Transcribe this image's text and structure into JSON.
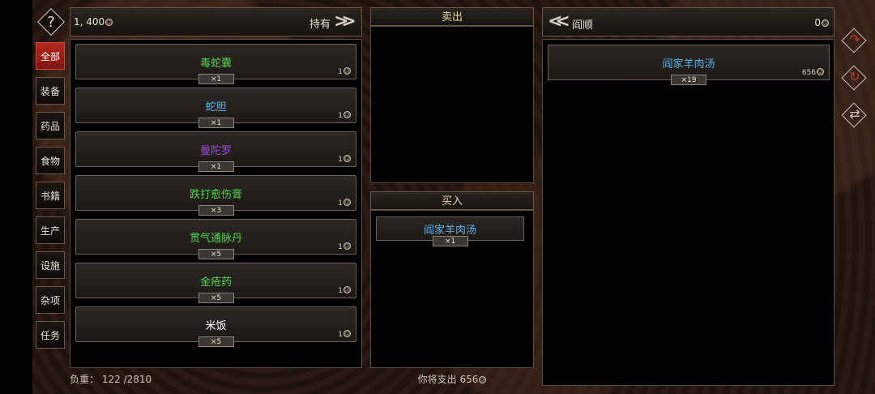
{
  "help": {
    "glyph": "?"
  },
  "categories": [
    {
      "label": "全部",
      "active": true
    },
    {
      "label": "装备",
      "active": false
    },
    {
      "label": "药品",
      "active": false
    },
    {
      "label": "食物",
      "active": false
    },
    {
      "label": "书籍",
      "active": false
    },
    {
      "label": "生产",
      "active": false
    },
    {
      "label": "设施",
      "active": false
    },
    {
      "label": "杂项",
      "active": false
    },
    {
      "label": "任务",
      "active": false
    }
  ],
  "inventory": {
    "money": "1, 400",
    "hold_label": "持有",
    "items": [
      {
        "name": "毒蛇囊",
        "qty": "×1",
        "price": "1",
        "color": "#54d44a"
      },
      {
        "name": "蛇胆",
        "qty": "×1",
        "price": "1",
        "color": "#58b4ea"
      },
      {
        "name": "曼陀罗",
        "qty": "×1",
        "price": "1",
        "color": "#a24ae6"
      },
      {
        "name": "跌打愈伤膏",
        "qty": "×3",
        "price": "1",
        "color": "#54d44a"
      },
      {
        "name": "贯气通脉丹",
        "qty": "×5",
        "price": "1",
        "color": "#54d44a"
      },
      {
        "name": "金疮药",
        "qty": "×5",
        "price": "1",
        "color": "#54d44a"
      },
      {
        "name": "米饭",
        "qty": "×5",
        "price": "1",
        "color": "#ffffff"
      }
    ],
    "load_label": "负重：",
    "load_value": "122 /2810"
  },
  "sell": {
    "title": "卖出"
  },
  "buy": {
    "title": "买入",
    "items": [
      {
        "name": "阎家羊肉汤",
        "qty": "×1"
      }
    ]
  },
  "spend": {
    "label": "你将支出",
    "value": "656"
  },
  "merchant": {
    "name": "阎顺",
    "money": "0",
    "items": [
      {
        "name": "阎家羊肉汤",
        "qty": "×19",
        "price": "656"
      }
    ]
  },
  "side_buttons": [
    {
      "icon": "redo-arrow-icon",
      "color": "#c0392b"
    },
    {
      "icon": "refresh-icon",
      "color": "#c0392b"
    },
    {
      "icon": "swap-icon",
      "color": "#cfc6b8"
    }
  ]
}
